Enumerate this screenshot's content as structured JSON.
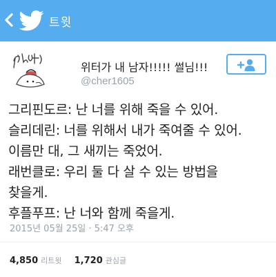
{
  "header": {
    "back_icon": "chevron-left-icon",
    "logo_icon": "twitter-bird-icon",
    "title": "트윗",
    "background": "#55acee"
  },
  "profile": {
    "display_name": "위터가 내 남자!!!!! 썰님!!!",
    "handle": "@cher1605",
    "follow_icon": "add-user-icon",
    "accent": "#55acee"
  },
  "tweet": {
    "lines": [
      "그리핀도르: 난 너를 위해 죽을 수 있어.",
      "슬리데린: 너를 위해서 내가 죽여줄 수 있어.",
      "이름만 대, 그 새끼는 죽었어.",
      "래번클로: 우리 둘 다 살 수 있는 방법을",
      "찾을게.",
      "후플푸프: 난 너와 함께 죽을게."
    ],
    "timestamp": "2015년 05월 25일 · 5:47 오후"
  },
  "stats": {
    "retweets": "4,850",
    "retweets_label": "리트윗",
    "likes": "1,720",
    "likes_label": "관심글"
  }
}
